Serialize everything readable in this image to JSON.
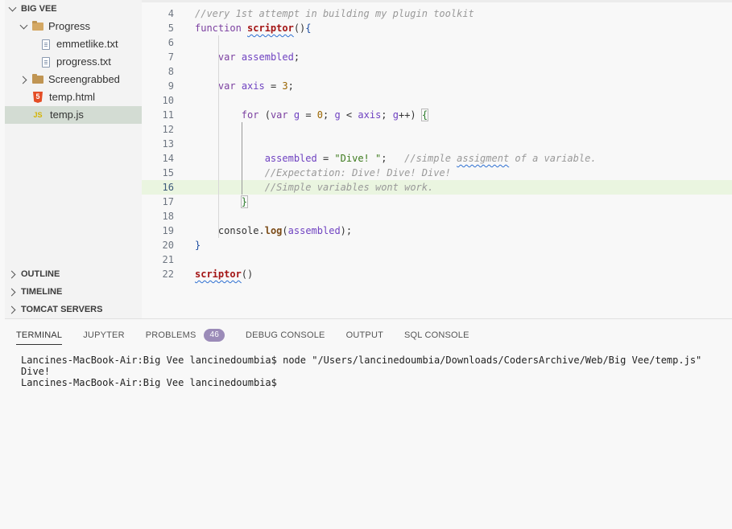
{
  "sidebar": {
    "root_label": "BIG VEE",
    "items": [
      {
        "label": "Progress",
        "type": "folder-open"
      },
      {
        "label": "emmetlike.txt",
        "type": "file"
      },
      {
        "label": "progress.txt",
        "type": "file"
      },
      {
        "label": "Screengrabbed",
        "type": "folder"
      },
      {
        "label": "temp.html",
        "type": "html"
      },
      {
        "label": "temp.js",
        "type": "js"
      }
    ],
    "js_glyph": "JS",
    "html_glyph": "5",
    "sections": [
      "OUTLINE",
      "TIMELINE",
      "TOMCAT SERVERS"
    ]
  },
  "editor": {
    "active_line": "16",
    "lines": [
      {
        "n": "4",
        "code": "//very 1st attempt in building my plugin toolkit"
      },
      {
        "n": "5",
        "code": "function scriptor(){"
      },
      {
        "n": "6",
        "code": ""
      },
      {
        "n": "7",
        "code": "    var assembled;"
      },
      {
        "n": "8",
        "code": ""
      },
      {
        "n": "9",
        "code": "    var axis = 3;"
      },
      {
        "n": "10",
        "code": ""
      },
      {
        "n": "11",
        "code": "        for (var g = 0; g < axis; g++) {"
      },
      {
        "n": "12",
        "code": ""
      },
      {
        "n": "13",
        "code": ""
      },
      {
        "n": "14",
        "code": "            assembled = \"Dive! \";   //simple assigment of a variable."
      },
      {
        "n": "15",
        "code": "            //Expectation: Dive! Dive! Dive!"
      },
      {
        "n": "16",
        "code": "            //Simple variables wont work."
      },
      {
        "n": "17",
        "code": "        }"
      },
      {
        "n": "18",
        "code": ""
      },
      {
        "n": "19",
        "code": "    console.log(assembled);"
      },
      {
        "n": "20",
        "code": "}"
      },
      {
        "n": "21",
        "code": ""
      },
      {
        "n": "22",
        "code": "scriptor()"
      }
    ]
  },
  "panel": {
    "tabs": [
      {
        "label": "TERMINAL",
        "active": true
      },
      {
        "label": "JUPYTER"
      },
      {
        "label": "PROBLEMS",
        "badge": "46"
      },
      {
        "label": "DEBUG CONSOLE"
      },
      {
        "label": "OUTPUT"
      },
      {
        "label": "SQL CONSOLE"
      }
    ],
    "terminal_lines": [
      "Lancines-MacBook-Air:Big Vee lancinedoumbia$ node \"/Users/lancinedoumbia/Downloads/CodersArchive/Web/Big Vee/temp.js\"",
      "Dive!",
      "Lancines-MacBook-Air:Big Vee lancinedoumbia$ "
    ]
  },
  "colors": {
    "selection": "#d3dcd3",
    "current_line": "#eaf5e0",
    "keyword": "#7b3fa0",
    "string": "#3d7a1d",
    "comment": "#999999",
    "badge": "#9b8bb8"
  }
}
